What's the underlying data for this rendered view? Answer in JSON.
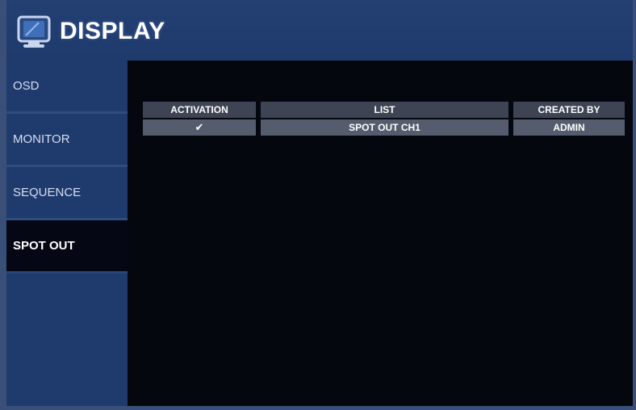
{
  "header": {
    "title": "DISPLAY",
    "icon": "monitor-icon"
  },
  "sidebar": {
    "items": [
      {
        "label": "OSD"
      },
      {
        "label": "MONITOR"
      },
      {
        "label": "SEQUENCE"
      },
      {
        "label": "SPOT OUT",
        "active": true
      }
    ]
  },
  "table": {
    "columns": [
      "ACTIVATION",
      "LIST",
      "CREATED BY"
    ],
    "rows": [
      {
        "activation": "✔",
        "list": "SPOT OUT CH1",
        "created_by": "ADMIN"
      }
    ]
  },
  "colors": {
    "frame": "#3a4f78",
    "panel_blue": "#1f3a6c",
    "content_bg": "#05070f",
    "header_cell": "#3e4453",
    "data_cell": "#555c6d"
  }
}
